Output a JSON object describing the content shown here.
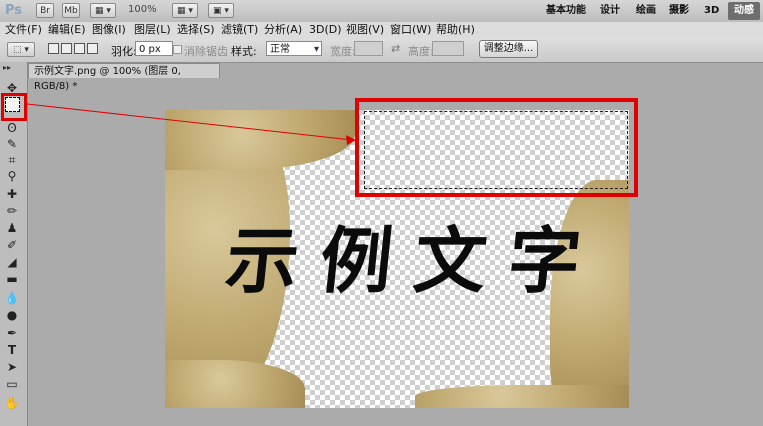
{
  "app": {
    "logo": "Ps",
    "bridge": "Br",
    "minibridge": "Mb",
    "zoom": "100%"
  },
  "workspaces": [
    "基本功能",
    "设计",
    "绘画",
    "摄影",
    "3D",
    "动感"
  ],
  "menu": [
    "文件(F)",
    "编辑(E)",
    "图像(I)",
    "图层(L)",
    "选择(S)",
    "滤镜(T)",
    "分析(A)",
    "3D(D)",
    "视图(V)",
    "窗口(W)",
    "帮助(H)"
  ],
  "options": {
    "feather_label": "羽化:",
    "feather_value": "0 px",
    "antialias_label": "消除锯齿",
    "style_label": "样式:",
    "style_value": "正常",
    "width_label": "宽度:",
    "height_label": "高度:",
    "refine_edge": "调整边缘..."
  },
  "document": {
    "tab_title": "示例文字.png @ 100% (图层 0, RGB/8) *",
    "artwork_text": "示例文字"
  },
  "colors": {
    "highlight": "#e00000"
  },
  "toolbox_icons": [
    "move-icon",
    "marquee-icon",
    "lasso-icon",
    "quick-select-icon",
    "crop-icon",
    "eyedropper-icon",
    "healing-brush-icon",
    "brush-icon",
    "clone-stamp-icon",
    "history-brush-icon",
    "eraser-icon",
    "gradient-icon",
    "blur-icon",
    "dodge-icon",
    "pen-icon",
    "type-icon",
    "path-select-icon",
    "shape-icon",
    "hand-icon"
  ]
}
